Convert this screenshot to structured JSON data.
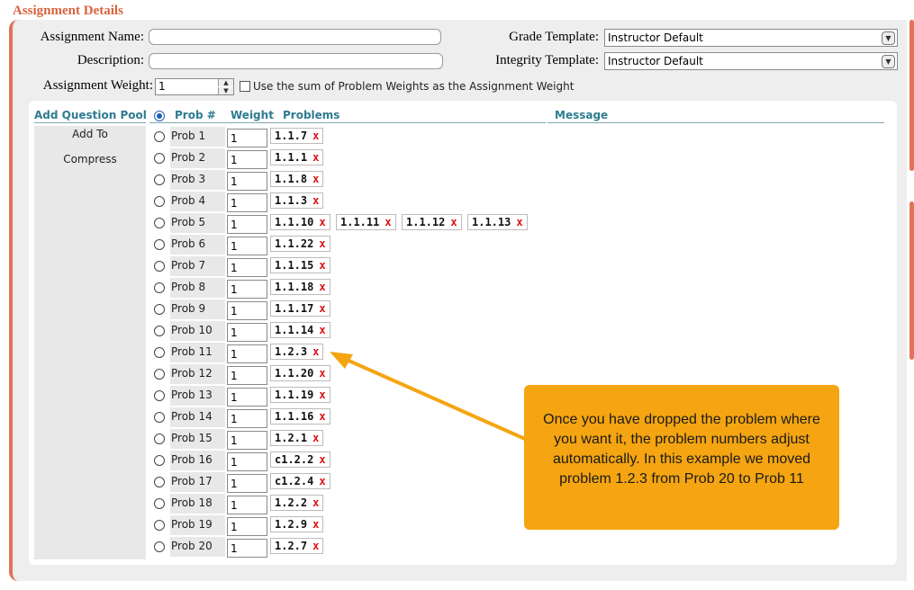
{
  "section_title": "Assignment Details",
  "form": {
    "assignment_name_label": "Assignment Name:",
    "assignment_name_value": "",
    "description_label": "Description:",
    "description_value": "",
    "grade_template_label": "Grade Template:",
    "grade_template_value": "Instructor Default",
    "integrity_template_label": "Integrity Template:",
    "integrity_template_value": "Instructor Default",
    "assignment_weight_label": "Assignment Weight:",
    "assignment_weight_value": "1",
    "sum_checkbox_label": "Use the sum of Problem Weights as the Assignment Weight",
    "sum_checkbox_checked": false
  },
  "table": {
    "headers": {
      "add_question_pool": "Add Question Pool",
      "prob": "Prob #",
      "weight": "Weight",
      "problems": "Problems",
      "message": "Message"
    },
    "side_actions": [
      "Add To",
      "Compress"
    ],
    "rows": [
      {
        "label": "Prob 1",
        "weight": "1",
        "problems": [
          "1.1.7"
        ]
      },
      {
        "label": "Prob 2",
        "weight": "1",
        "problems": [
          "1.1.1"
        ]
      },
      {
        "label": "Prob 3",
        "weight": "1",
        "problems": [
          "1.1.8"
        ]
      },
      {
        "label": "Prob 4",
        "weight": "1",
        "problems": [
          "1.1.3"
        ]
      },
      {
        "label": "Prob 5",
        "weight": "1",
        "problems": [
          "1.1.10",
          "1.1.11",
          "1.1.12",
          "1.1.13"
        ]
      },
      {
        "label": "Prob 6",
        "weight": "1",
        "problems": [
          "1.1.22"
        ]
      },
      {
        "label": "Prob 7",
        "weight": "1",
        "problems": [
          "1.1.15"
        ]
      },
      {
        "label": "Prob 8",
        "weight": "1",
        "problems": [
          "1.1.18"
        ]
      },
      {
        "label": "Prob 9",
        "weight": "1",
        "problems": [
          "1.1.17"
        ]
      },
      {
        "label": "Prob 10",
        "weight": "1",
        "problems": [
          "1.1.14"
        ]
      },
      {
        "label": "Prob 11",
        "weight": "1",
        "problems": [
          "1.2.3"
        ]
      },
      {
        "label": "Prob 12",
        "weight": "1",
        "problems": [
          "1.1.20"
        ]
      },
      {
        "label": "Prob 13",
        "weight": "1",
        "problems": [
          "1.1.19"
        ]
      },
      {
        "label": "Prob 14",
        "weight": "1",
        "problems": [
          "1.1.16"
        ]
      },
      {
        "label": "Prob 15",
        "weight": "1",
        "problems": [
          "1.2.1"
        ]
      },
      {
        "label": "Prob 16",
        "weight": "1",
        "problems": [
          "c1.2.2"
        ]
      },
      {
        "label": "Prob 17",
        "weight": "1",
        "problems": [
          "c1.2.4"
        ]
      },
      {
        "label": "Prob 18",
        "weight": "1",
        "problems": [
          "1.2.2"
        ]
      },
      {
        "label": "Prob 19",
        "weight": "1",
        "problems": [
          "1.2.9"
        ]
      },
      {
        "label": "Prob 20",
        "weight": "1",
        "problems": [
          "1.2.7"
        ]
      }
    ],
    "remove_glyph": "x"
  },
  "callout": {
    "text": "Once you have dropped the problem where you want it, the problem numbers adjust automatically.  In this example we moved problem 1.2.3 from Prob 20 to Prob 11"
  },
  "colors": {
    "accent_border": "#e0735a",
    "header_text": "#d9623e",
    "table_header_text": "#2e7b90",
    "callout_bg": "#f5a511",
    "remove_x": "#dd1111",
    "radio_selected": "#1f5fb5"
  }
}
